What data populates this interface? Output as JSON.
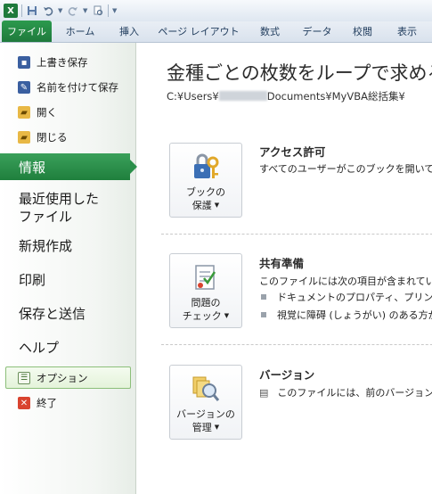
{
  "qat": {
    "app_icon": "X",
    "icons": [
      "excel-icon",
      "save-icon",
      "undo-icon",
      "redo-icon",
      "print-preview-icon",
      "customize-icon"
    ]
  },
  "tabs": [
    {
      "label": "ファイル",
      "selected": true
    },
    {
      "label": "ホーム"
    },
    {
      "label": "挿入"
    },
    {
      "label": "ページ レイアウト"
    },
    {
      "label": "数式"
    },
    {
      "label": "データ"
    },
    {
      "label": "校閲"
    },
    {
      "label": "表示"
    }
  ],
  "backstage": {
    "commands_top": [
      {
        "label": "上書き保存",
        "icon": "save-icon"
      },
      {
        "label": "名前を付けて保存",
        "icon": "save-as-icon"
      },
      {
        "label": "開く",
        "icon": "open-folder-icon"
      },
      {
        "label": "閉じる",
        "icon": "close-folder-icon"
      }
    ],
    "info": "情報",
    "recent_line1": "最近使用した",
    "recent_line2": "ファイル",
    "new": "新規作成",
    "print": "印刷",
    "save_send": "保存と送信",
    "help": "ヘルプ",
    "options": "オプション",
    "exit": "終了"
  },
  "main": {
    "title": "金種ごとの枚数をループで求める",
    "path_prefix": "C:¥Users¥",
    "path_suffix": "Documents¥MyVBA総括集¥",
    "permissions": {
      "button_line1": "ブックの",
      "button_line2": "保護",
      "heading": "アクセス許可",
      "text": "すべてのユーザーがこのブックを開いてこの"
    },
    "prepare": {
      "button_line1": "問題の",
      "button_line2": "チェック",
      "heading": "共有準備",
      "text": "このファイルには次の項目が含まれています",
      "bullet1": "ドキュメントのプロパティ、プリンターの",
      "bullet2": "視覚に障碍 (しょうがい) のある方が"
    },
    "versions": {
      "button_line1": "バージョンの",
      "button_line2": "管理",
      "heading": "バージョン",
      "text": "このファイルには、前のバージョンはあ"
    }
  }
}
